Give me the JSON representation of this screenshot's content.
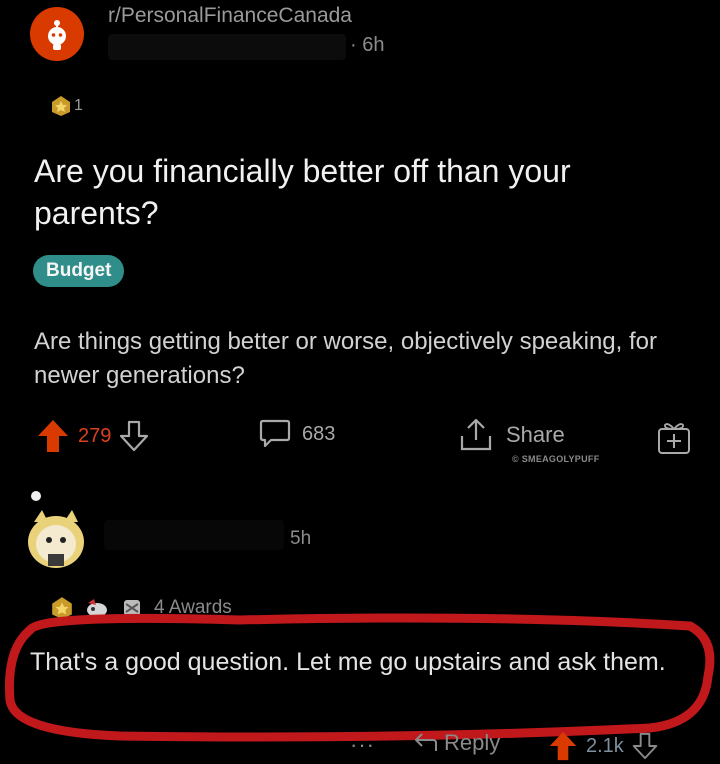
{
  "post": {
    "subreddit": "r/PersonalFinanceCanada",
    "time": "· 6h",
    "award_count": "1",
    "title": "Are you financially better off than your parents?",
    "flair": "Budget",
    "body": "Are things getting better or worse, objectively speaking, for newer generations?",
    "score": "279",
    "comments": "683",
    "share_label": "Share",
    "watermark": "© SMEAGOLYPUFF"
  },
  "comment": {
    "time": "5h",
    "awards_label": "4 Awards",
    "text": "That's a good question. Let me go upstairs and ask them.",
    "more": "···",
    "reply_label": "Reply",
    "score": "2.1k"
  },
  "colors": {
    "upvote": "#d93a00",
    "flair": "#2f8e8a",
    "highlight_circle": "#c0181b"
  },
  "icons": [
    "reddit-alien-icon",
    "award-icon",
    "upvote-arrow-icon",
    "downvote-arrow-icon",
    "comment-bubble-icon",
    "share-icon",
    "gift-award-icon",
    "reply-arrow-icon"
  ]
}
